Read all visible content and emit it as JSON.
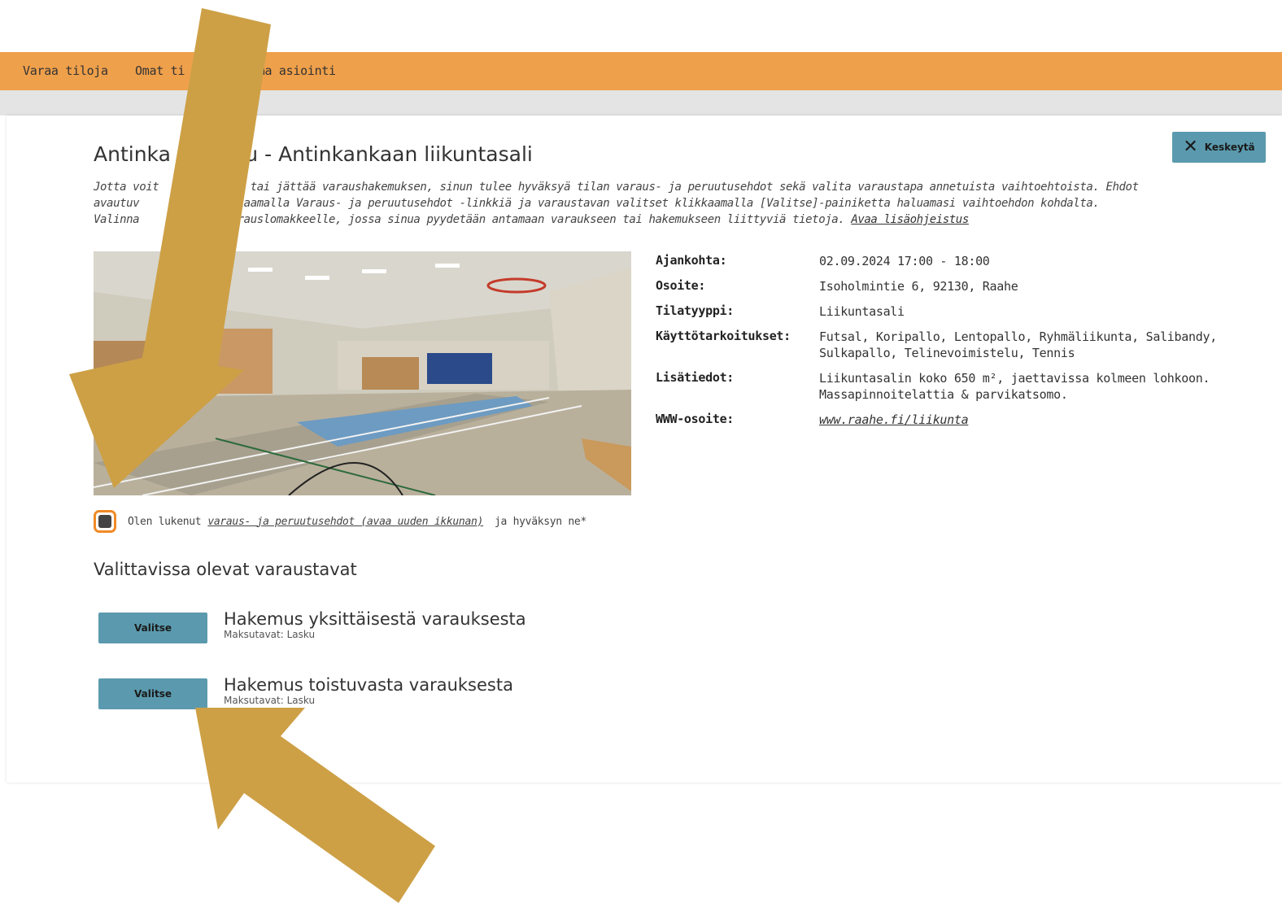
{
  "nav": {
    "items": [
      "Varaa tiloja",
      "Omat ti",
      "oma asiointi"
    ]
  },
  "header": {
    "cancel_label": "Keskeytä",
    "title": "Antinka     koulu - Antinkankaan liikuntasali"
  },
  "intro": {
    "line1": "Jotta voit        uksen tai jättää varaushakemuksen, sinun tulee hyväksyä tilan varaus- ja peruutusehdot sekä valita varaustapa annetuista vaihtoehtoista. Ehdot",
    "line2": "avautuv        si klikkaamalla Varaus- ja peruutusehdot -linkkiä ja varaustavan valitset klikkaamalla [Valitse]-painiketta haluamasi vaihtoehdon kohdalta.",
    "line3": "Valinna        rryt varauslomakkeelle, jossa sinua pyydetään antamaan varaukseen tai hakemukseen liittyviä tietoja.",
    "help_link": "Avaa lisäohjeistus"
  },
  "details": {
    "rows": [
      {
        "label": "Ajankohta:",
        "value": "02.09.2024 17:00 - 18:00"
      },
      {
        "label": "Osoite:",
        "value": "Isoholmintie 6, 92130, Raahe"
      },
      {
        "label": "Tilatyyppi:",
        "value": "Liikuntasali"
      },
      {
        "label": "Käyttötarkoitukset:",
        "value": "Futsal, Koripallo, Lentopallo, Ryhmäliikunta, Salibandy, Sulkapallo, Telinevoimistelu, Tennis"
      },
      {
        "label": "Lisätiedot:",
        "value": "Liikuntasalin koko 650 m², jaettavissa kolmeen lohkoon. Massapinnoitelattia & parvikatsomo."
      },
      {
        "label": "WWW-osoite:",
        "value": "www.raahe.fi/liikunta"
      }
    ]
  },
  "consent": {
    "prefix": "Olen lukenut",
    "link": "varaus- ja peruutusehdot (avaa uuden ikkunan)",
    "suffix": "ja hyväksyn ne*"
  },
  "booking": {
    "section_title": "Valittavissa olevat varaustavat",
    "options": [
      {
        "button": "Valitse",
        "title": "Hakemus yksittäisestä varauksesta",
        "subtitle": "Maksutavat: Lasku"
      },
      {
        "button": "Valitse",
        "title": "Hakemus toistuvasta varauksesta",
        "subtitle": "Maksutavat: Lasku"
      }
    ]
  },
  "colors": {
    "topbar": "#efa04b",
    "button": "#5b9aae",
    "arrow": "#cda046",
    "checkbox_border": "#f08a25"
  }
}
